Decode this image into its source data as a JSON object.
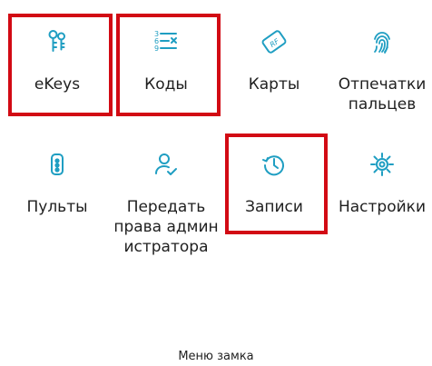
{
  "grid": {
    "row1": [
      {
        "id": "ekeys",
        "label": "eKeys",
        "icon": "keys-icon"
      },
      {
        "id": "codes",
        "label": "Коды",
        "icon": "passcode-list-icon"
      },
      {
        "id": "cards",
        "label": "Карты",
        "icon": "rf-card-icon"
      },
      {
        "id": "fingerprints",
        "label": "Отпечатки\nпальцев",
        "icon": "fingerprint-icon"
      }
    ],
    "row2": [
      {
        "id": "remotes",
        "label": "Пульты",
        "icon": "remote-icon"
      },
      {
        "id": "transfer",
        "label": "Передать\nправа админ\nистратора",
        "icon": "user-check-icon"
      },
      {
        "id": "records",
        "label": "Записи",
        "icon": "history-icon"
      },
      {
        "id": "settings",
        "label": "Настройки",
        "icon": "gear-icon"
      }
    ]
  },
  "footer": {
    "label": "Меню замка"
  },
  "colors": {
    "accent": "#1f9ec2",
    "highlight": "#d20a14"
  }
}
